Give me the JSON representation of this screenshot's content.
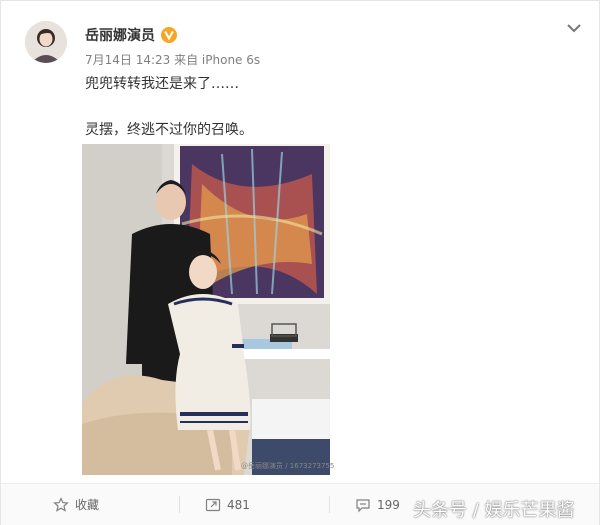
{
  "post": {
    "username": "岳丽娜演员",
    "meta": "7月14日 14:23 来自 iPhone 6s",
    "line1": "兜兜转转我还是来了……",
    "line2": "灵摆，终逃不过你的召唤。",
    "photo_watermark": "@岳丽娜演员 / 1673273755"
  },
  "footer": {
    "favorite_label": "收藏",
    "repost_count": "481",
    "comment_count": "199"
  },
  "overlay": {
    "watermark": "头条号 / 娱乐芒果酱"
  },
  "colors": {
    "verified": "#f6a623",
    "text_primary": "#333333",
    "text_meta": "#808080"
  },
  "icons": {
    "verified": "verified-badge-icon",
    "chevron": "chevron-down-icon",
    "favorite": "star-icon",
    "repost": "repost-icon",
    "comment": "comment-icon"
  }
}
